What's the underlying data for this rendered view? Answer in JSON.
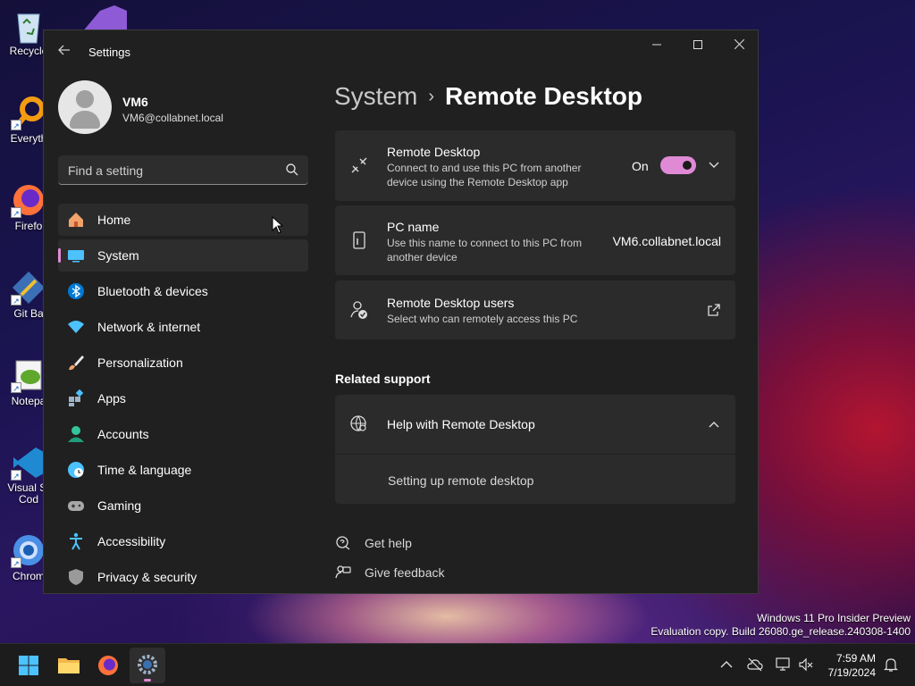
{
  "desktop": {
    "icons": [
      {
        "label": "Recycle",
        "icon": "recycle-bin-icon"
      },
      {
        "label": "Everyth",
        "icon": "everything-search-icon"
      },
      {
        "label": "Firefo",
        "icon": "firefox-icon"
      },
      {
        "label": "Git Ba",
        "icon": "git-bash-icon"
      },
      {
        "label": "Notepa",
        "icon": "notepad-plus-plus-icon"
      },
      {
        "label": "Visual St Cod",
        "icon": "vscode-icon"
      },
      {
        "label": "Chrom",
        "icon": "chrome-icon"
      }
    ],
    "watermark": {
      "line1": "Windows 11 Pro Insider Preview",
      "line2": "Evaluation copy. Build 26080.ge_release.240308-1400"
    }
  },
  "window": {
    "title": "Settings",
    "back_icon": "arrow-left-icon",
    "controls": {
      "minimize": "minimize-icon",
      "maximize": "maximize-icon",
      "close": "close-icon"
    }
  },
  "profile": {
    "name": "VM6",
    "email": "VM6@collabnet.local"
  },
  "search": {
    "placeholder": "Find a setting",
    "icon": "search-icon"
  },
  "sidebar": {
    "items": [
      {
        "label": "Home",
        "icon": "home-icon"
      },
      {
        "label": "System",
        "icon": "system-icon"
      },
      {
        "label": "Bluetooth & devices",
        "icon": "bluetooth-icon"
      },
      {
        "label": "Network & internet",
        "icon": "wifi-icon"
      },
      {
        "label": "Personalization",
        "icon": "brush-icon"
      },
      {
        "label": "Apps",
        "icon": "apps-icon"
      },
      {
        "label": "Accounts",
        "icon": "accounts-icon"
      },
      {
        "label": "Time & language",
        "icon": "globe-clock-icon"
      },
      {
        "label": "Gaming",
        "icon": "gamepad-icon"
      },
      {
        "label": "Accessibility",
        "icon": "accessibility-icon"
      },
      {
        "label": "Privacy & security",
        "icon": "shield-icon"
      }
    ],
    "selected": "System"
  },
  "breadcrumb": {
    "parent": "System",
    "separator": "›",
    "current": "Remote Desktop"
  },
  "remote_desktop": {
    "title": "Remote Desktop",
    "description": "Connect to and use this PC from another device using the Remote Desktop app",
    "toggle_label": "On",
    "toggle_on": true
  },
  "pc_name": {
    "title": "PC name",
    "description": "Use this name to connect to this PC from another device",
    "value": "VM6.collabnet.local"
  },
  "rd_users": {
    "title": "Remote Desktop users",
    "description": "Select who can remotely access this PC"
  },
  "related_support": {
    "heading": "Related support",
    "help_title": "Help with Remote Desktop",
    "links": [
      "Setting up remote desktop"
    ]
  },
  "footer_links": {
    "get_help": "Get help",
    "give_feedback": "Give feedback"
  },
  "taskbar": {
    "apps": [
      "start-icon",
      "file-explorer-icon",
      "firefox-icon",
      "settings-icon"
    ],
    "clock_time": "7:59 AM",
    "clock_date": "7/19/2024"
  },
  "colors": {
    "accent": "#e08ad6",
    "window_bg": "#202020",
    "card_bg": "#2b2b2b"
  }
}
